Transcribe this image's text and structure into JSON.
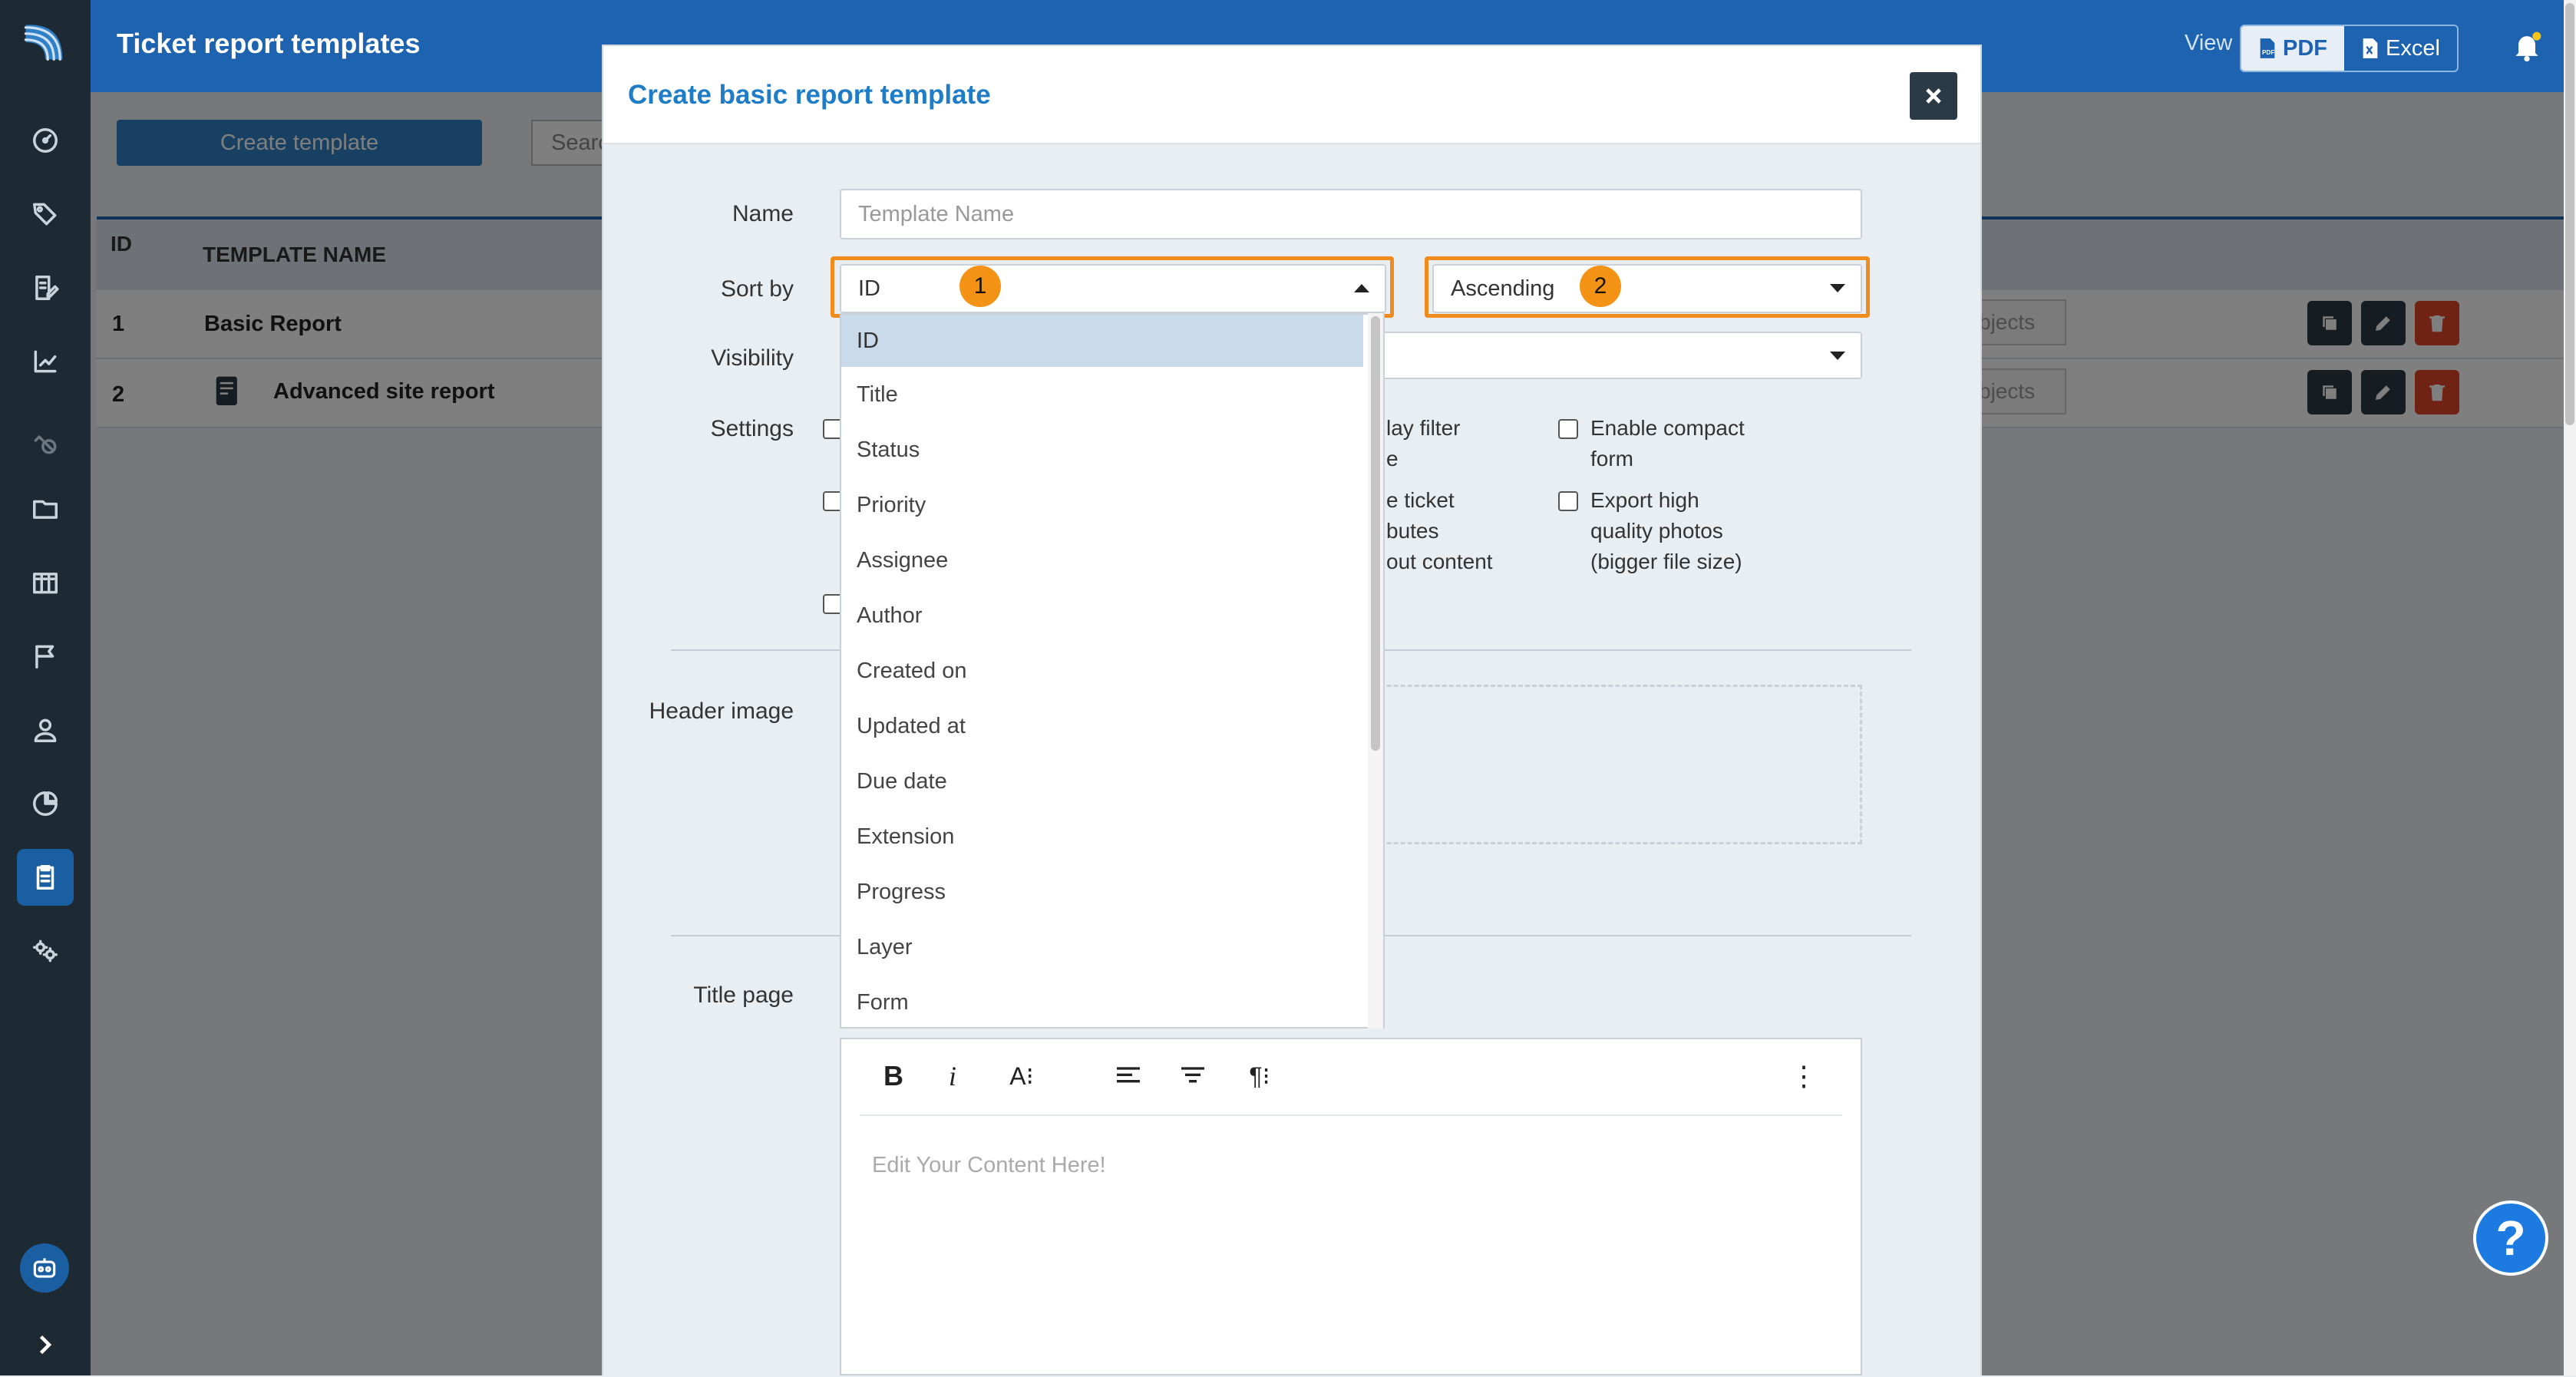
{
  "app": {
    "title": "Ticket report templates",
    "view_label": "View",
    "pdf_label": "PDF",
    "excel_label": "Excel"
  },
  "sidebar": {
    "items": [
      {
        "icon": "dashboard-icon"
      },
      {
        "icon": "tags-icon"
      },
      {
        "icon": "report-edit-icon"
      },
      {
        "icon": "chart-icon"
      },
      {
        "icon": "disabled-icon"
      },
      {
        "icon": "folder-icon"
      },
      {
        "icon": "catalog-icon"
      },
      {
        "icon": "flag-icon"
      },
      {
        "icon": "user-icon"
      },
      {
        "icon": "pie-chart-icon"
      },
      {
        "icon": "clipboard-icon",
        "active": true
      },
      {
        "icon": "gears-icon"
      }
    ]
  },
  "page": {
    "create_button": "Create template",
    "search_placeholder": "Search",
    "table": {
      "headers": [
        "ID",
        "TEMPLATE NAME"
      ],
      "rows": [
        {
          "id": "1",
          "name": "Basic Report",
          "objects": "bjects"
        },
        {
          "id": "2",
          "name": "Advanced site report",
          "objects": "bjects"
        }
      ]
    }
  },
  "modal": {
    "title": "Create basic report template",
    "labels": {
      "name": "Name",
      "sort_by": "Sort by",
      "visibility": "Visibility",
      "settings": "Settings",
      "header_image": "Header image",
      "title_page": "Title page"
    },
    "name_placeholder": "Template Name",
    "sort_by_value": "ID",
    "sort_order_value": "Ascending",
    "badges": [
      "1",
      "2"
    ],
    "sort_options": [
      "ID",
      "Title",
      "Status",
      "Priority",
      "Assignee",
      "Author",
      "Created on",
      "Updated at",
      "Due date",
      "Extension",
      "Progress",
      "Layer",
      "Form"
    ],
    "selected_option": "ID",
    "settings_fragments": {
      "col2_a": [
        "lay filter",
        "e"
      ],
      "col2_b": [
        "e ticket",
        "butes",
        "out content"
      ],
      "enable_compact": [
        "Enable compact",
        "form"
      ],
      "export_high": [
        "Export high",
        "quality photos",
        "(bigger file size)"
      ]
    },
    "editor": {
      "placeholder": "Edit Your Content Here!",
      "toolbar": {
        "bold": "B",
        "italic": "i",
        "font_size": "A⁝",
        "paragraph": "¶⁝",
        "more": "⋮"
      }
    }
  },
  "help": {
    "label": "?"
  },
  "colors": {
    "topbar": "#1d63b0",
    "sidebar": "#1e2a33",
    "accent": "#1f7cc7",
    "highlight": "#f08c1e",
    "delete": "#e0442a"
  }
}
